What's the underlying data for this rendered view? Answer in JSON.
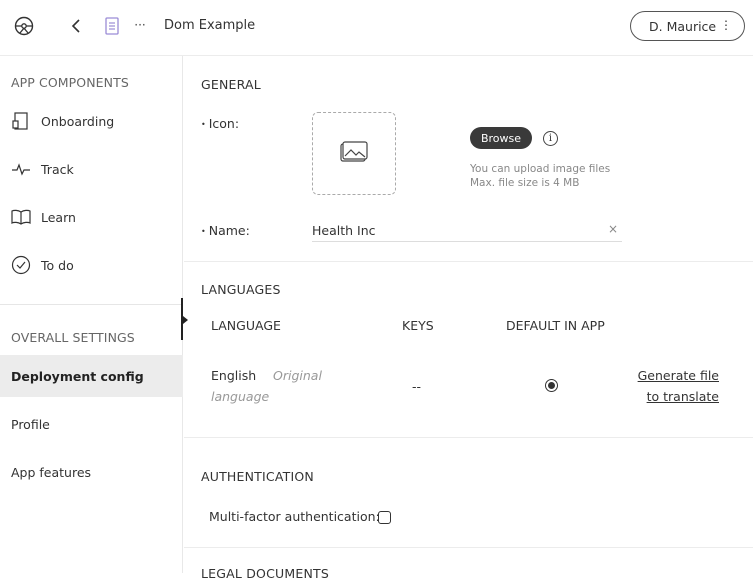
{
  "header": {
    "app_name": "Dom Example",
    "user_name": "D. Maurice",
    "kebab": "⋮",
    "more": "···"
  },
  "sidebar": {
    "app_components_title": "APP COMPONENTS",
    "components": [
      {
        "label": "Onboarding",
        "icon": "onboarding-icon"
      },
      {
        "label": "Track",
        "icon": "pulse-icon"
      },
      {
        "label": "Learn",
        "icon": "book-icon"
      },
      {
        "label": "To do",
        "icon": "check-circle-icon"
      }
    ],
    "overall_settings_title": "OVERALL SETTINGS",
    "settings": [
      {
        "label": "Deployment config",
        "active": true
      },
      {
        "label": "Profile",
        "active": false
      },
      {
        "label": "App features",
        "active": false
      }
    ]
  },
  "general": {
    "title": "GENERAL",
    "icon_label": "Icon",
    "browse_label": "Browse",
    "hint_line1": "You can upload image files",
    "hint_line2": "Max. file size is 4 MB",
    "name_label": "Name",
    "name_value": "Health Inc",
    "clear": "×"
  },
  "languages": {
    "title": "LANGUAGES",
    "columns": [
      "LANGUAGE",
      "KEYS",
      "DEFAULT IN APP"
    ],
    "row": {
      "language": "English",
      "note_line1": "Original",
      "note_line2": "language",
      "keys": "--",
      "default": true,
      "action_line1": "Generate file",
      "action_line2": "to translate"
    }
  },
  "authentication": {
    "title": "AUTHENTICATION",
    "mfa_label": "Multi-factor authentication:",
    "mfa_enabled": false
  },
  "legal": {
    "title": "LEGAL DOCUMENTS"
  },
  "colors": {
    "accent": "#3a3a3a",
    "doc_icon": "#9b8cd6",
    "active_bg": "#ececec"
  }
}
